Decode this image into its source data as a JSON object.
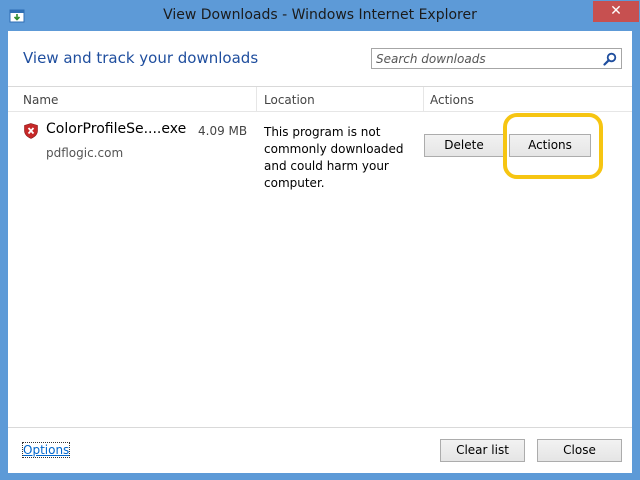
{
  "window": {
    "title": "View Downloads - Windows Internet Explorer",
    "close_label": "✕"
  },
  "header": {
    "heading": "View and track your downloads",
    "search_placeholder": "Search downloads"
  },
  "columns": {
    "name": "Name",
    "location": "Location",
    "actions": "Actions"
  },
  "downloads": [
    {
      "file_name": "ColorProfileSe....exe",
      "size": "4.09 MB",
      "source": "pdflogic.com",
      "warning": "This program is not commonly downloaded and could harm your computer.",
      "delete_label": "Delete",
      "actions_label": "Actions"
    }
  ],
  "footer": {
    "options_label": "Options",
    "clear_list_label": "Clear list",
    "close_label": "Close"
  },
  "colors": {
    "window_frame": "#5d9ad7",
    "heading": "#1f4e9e",
    "close_button": "#c75050",
    "highlight": "#f6c512",
    "warning_shield": "#c62828"
  },
  "icons": {
    "app": "download-manager-icon",
    "search": "magnifier-icon",
    "file": "red-shield-x-icon"
  }
}
